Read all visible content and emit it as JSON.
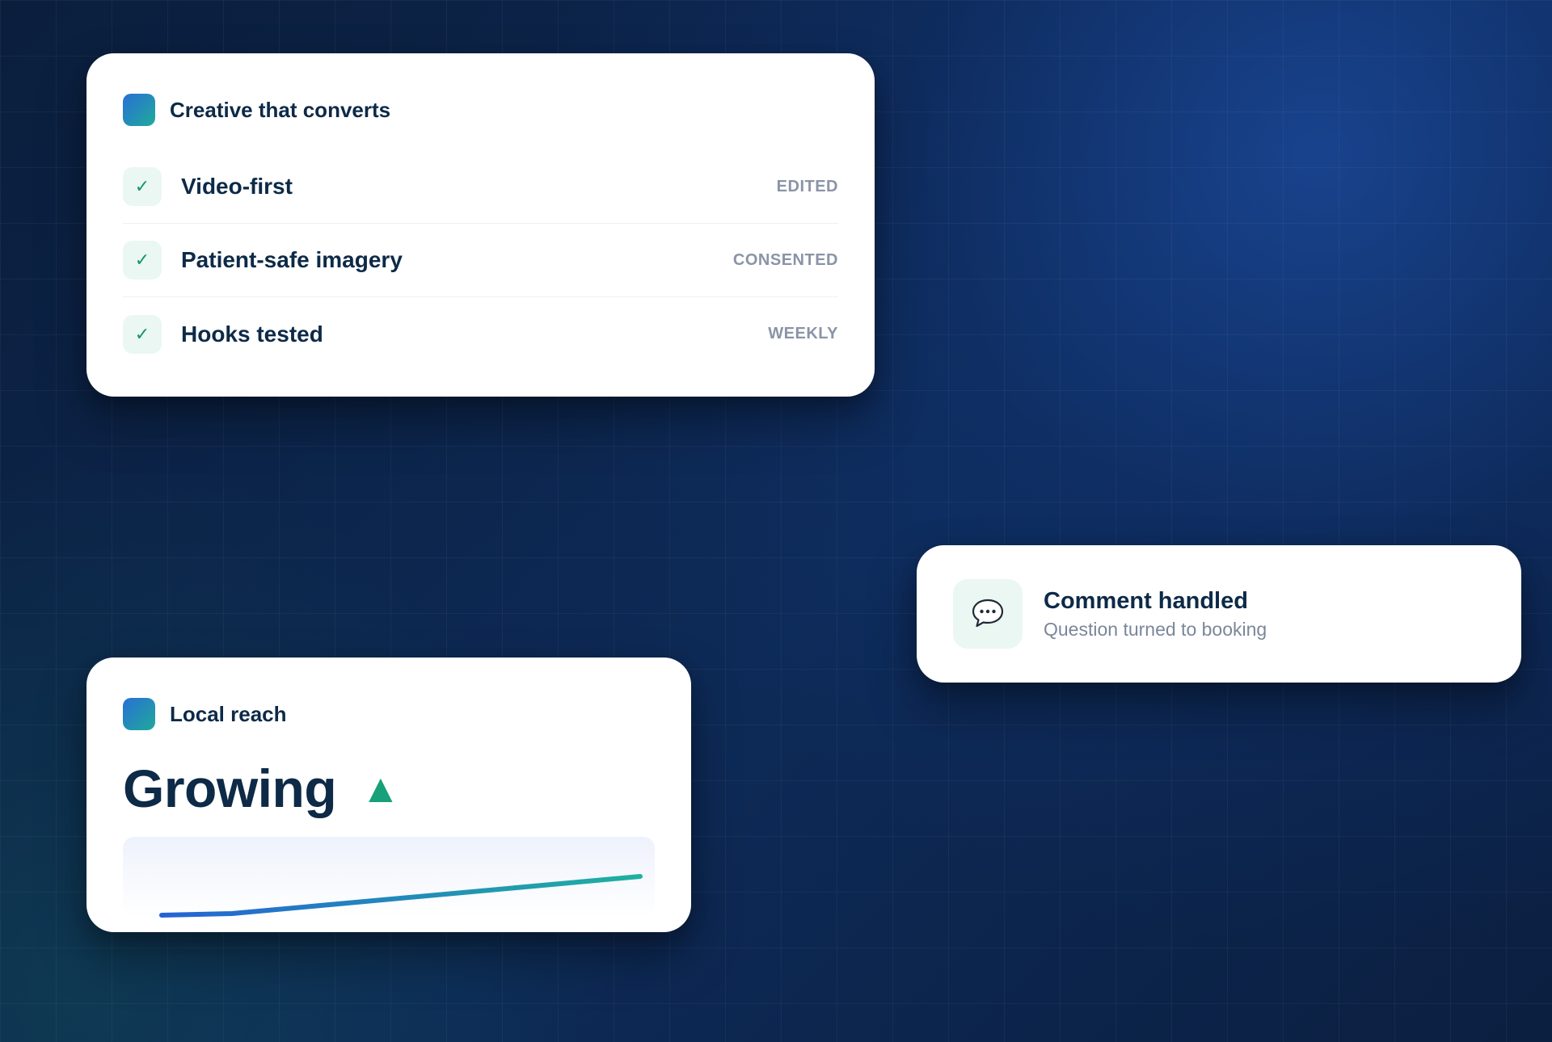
{
  "checklist_card": {
    "title": "Creative that converts",
    "items": [
      {
        "label": "Video-first",
        "tag": "EDITED",
        "check": "✓"
      },
      {
        "label": "Patient-safe imagery",
        "tag": "CONSENTED",
        "check": "✓"
      },
      {
        "label": "Hooks tested",
        "tag": "WEEKLY",
        "check": "✓"
      }
    ]
  },
  "comment_card": {
    "title": "Comment handled",
    "subtitle": "Question turned to booking",
    "icon": "speech-bubble-icon"
  },
  "reach_card": {
    "title": "Local reach",
    "value": "Growing",
    "trend_symbol": "▲"
  },
  "colors": {
    "brand_blue": "#2a6fd6",
    "brand_teal": "#1faa9a",
    "text_dark": "#0d2a47",
    "tag_gray": "#8a94a6",
    "success_green": "#18a07a",
    "background": "#0a1f3f"
  }
}
